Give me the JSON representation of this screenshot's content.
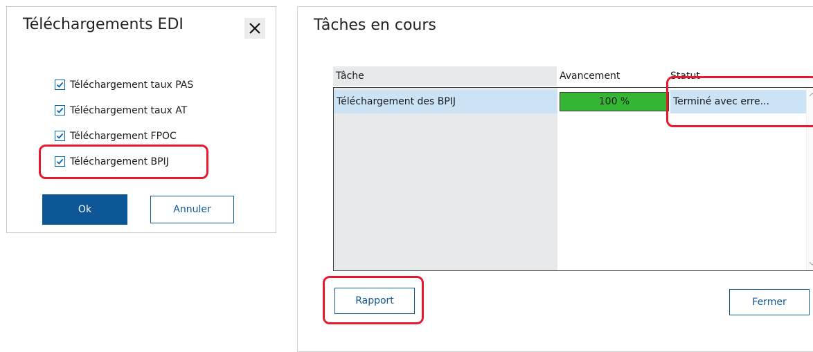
{
  "edi_dialog": {
    "title": "Téléchargements EDI",
    "close_icon": "close-icon",
    "options": [
      {
        "label": "Téléchargement taux PAS",
        "checked": true
      },
      {
        "label": "Téléchargement taux AT",
        "checked": true
      },
      {
        "label": "Téléchargement FPOC",
        "checked": true
      },
      {
        "label": "Téléchargement BPIJ",
        "checked": true
      }
    ],
    "ok_label": "Ok",
    "cancel_label": "Annuler"
  },
  "tasks_dialog": {
    "title": "Tâches en cours",
    "columns": [
      "Tâche",
      "Avancement",
      "Statut"
    ],
    "rows": [
      {
        "task": "Téléchargement des BPIJ",
        "progress_text": "100 %",
        "progress_fraction": 1.0,
        "status": "Terminé avec erre..."
      }
    ],
    "report_label": "Rapport",
    "close_label": "Fermer"
  },
  "colors": {
    "accent": "#0e5797",
    "progress": "#34b534",
    "selection": "#cce3f5",
    "highlight": "#e8192c"
  }
}
